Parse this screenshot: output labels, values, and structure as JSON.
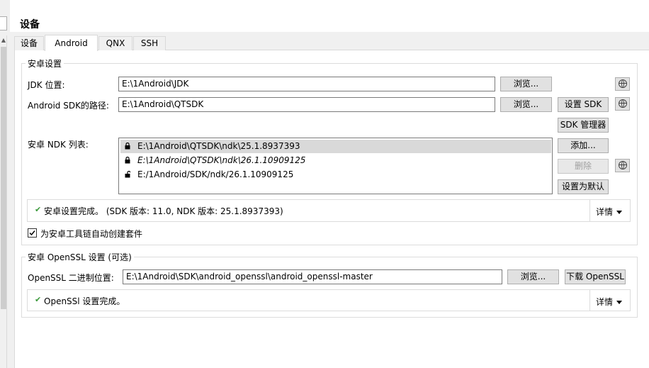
{
  "page": {
    "title": "设备"
  },
  "tabs": [
    {
      "label": "设备"
    },
    {
      "label": "Android"
    },
    {
      "label": "QNX"
    },
    {
      "label": "SSH"
    }
  ],
  "android_settings": {
    "group_title": "安卓设置",
    "jdk_label": "JDK 位置:",
    "jdk_value": "E:\\1Android\\JDK",
    "sdk_label": "Android SDK的路径:",
    "sdk_value": "E:\\1Android\\QTSDK",
    "browse_label": "浏览...",
    "set_sdk_label": "设置 SDK",
    "sdk_manager_label": "SDK 管理器",
    "ndk_list_label": "安卓 NDK 列表:",
    "ndk_items": [
      {
        "path": "E:\\1Android\\QTSDK\\ndk\\25.1.8937393",
        "locked": true,
        "italic": false,
        "selected": true
      },
      {
        "path": "E:\\1Android\\QTSDK\\ndk\\26.1.10909125",
        "locked": true,
        "italic": true,
        "selected": false
      },
      {
        "path": "E:/1Android/SDK/ndk/26.1.10909125",
        "locked": false,
        "italic": false,
        "selected": false
      }
    ],
    "add_label": "添加...",
    "remove_label": "删除",
    "set_default_label": "设置为默认",
    "status_text": "安卓设置完成。 (SDK 版本: 11.0,  NDK 版本: 25.1.8937393)",
    "details_label": "详情",
    "auto_kit_label": "为安卓工具链自动创建套件",
    "auto_kit_checked": true
  },
  "openssl": {
    "group_title": "安卓 OpenSSL 设置 (可选)",
    "path_label": "OpenSSL 二进制位置:",
    "path_value": "E:\\1Android\\SDK\\android_openssl\\android_openssl-master",
    "browse_label": "浏览...",
    "download_label": "下载 OpenSSL",
    "status_text": "OpenSSl 设置完成。",
    "details_label": "详情"
  }
}
